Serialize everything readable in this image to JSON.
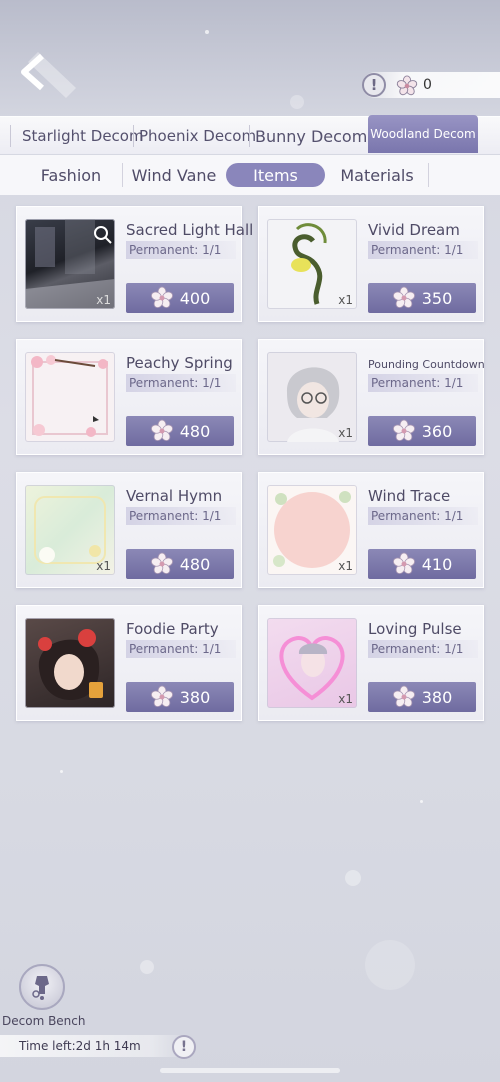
{
  "currency": {
    "count": "0",
    "icon": "sakura-flower-icon"
  },
  "decom_tabs": [
    {
      "label": "Starlight Decom"
    },
    {
      "label": "Phoenix Decom"
    },
    {
      "label": "Bunny Decom"
    },
    {
      "label": "Woodland Decom",
      "active": true
    }
  ],
  "sub_tabs": [
    {
      "label": "Fashion"
    },
    {
      "label": "Wind Vane"
    },
    {
      "label": "Items",
      "active": true
    },
    {
      "label": "Materials"
    }
  ],
  "items": [
    {
      "name": "Sacred Light Hall",
      "perm": "Permanent: 1/1",
      "qty": "x1",
      "price": "400"
    },
    {
      "name": "Vivid Dream",
      "perm": "Permanent: 1/1",
      "qty": "x1",
      "price": "350"
    },
    {
      "name": "Peachy Spring",
      "perm": "Permanent: 1/1",
      "qty": "",
      "price": "480"
    },
    {
      "name": "Pounding Countdown",
      "perm": "Permanent: 1/1",
      "qty": "x1",
      "price": "360"
    },
    {
      "name": "Vernal Hymn",
      "perm": "Permanent: 1/1",
      "qty": "x1",
      "price": "480"
    },
    {
      "name": "Wind Trace",
      "perm": "Permanent: 1/1",
      "qty": "x1",
      "price": "410"
    },
    {
      "name": "Foodie Party",
      "perm": "Permanent: 1/1",
      "qty": "",
      "price": "380"
    },
    {
      "name": "Loving Pulse",
      "perm": "Permanent: 1/1",
      "qty": "x1",
      "price": "380"
    }
  ],
  "bench": {
    "label": "Decom Bench"
  },
  "timer": {
    "text": "Time left:2d 1h 14m"
  },
  "colors": {
    "accent": "#7a76ad",
    "price_button": "#6f6ba0"
  }
}
